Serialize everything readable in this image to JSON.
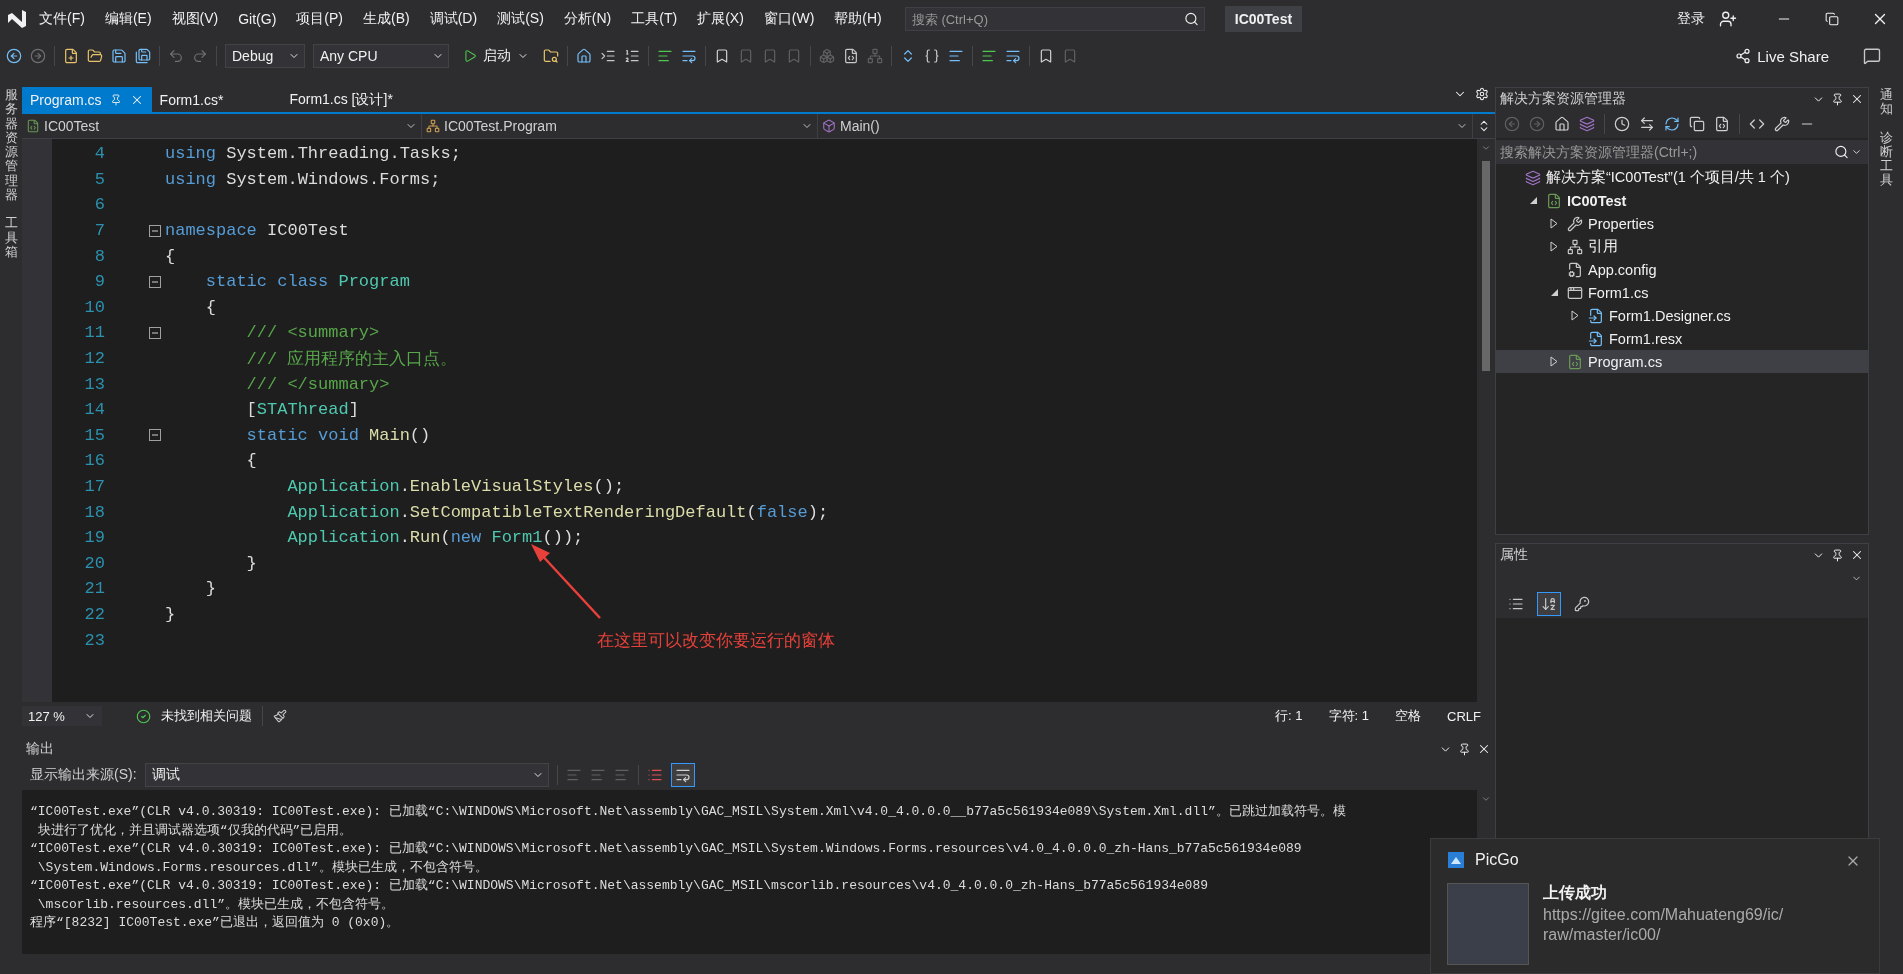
{
  "title_bar": {
    "menu": [
      "文件(F)",
      "编辑(E)",
      "视图(V)",
      "Git(G)",
      "项目(P)",
      "生成(B)",
      "调试(D)",
      "测试(S)",
      "分析(N)",
      "工具(T)",
      "扩展(X)",
      "窗口(W)",
      "帮助(H)"
    ],
    "search": {
      "placeholder": "搜索 (Ctrl+Q)"
    },
    "solution_name": "IC00Test",
    "sign_in": "登录"
  },
  "toolbar": {
    "configuration": "Debug",
    "platform": "Any CPU",
    "start": "启动",
    "live_share": "Live Share"
  },
  "left_strip": [
    "服务器资源管理器",
    "工具箱"
  ],
  "doc_tabs": [
    {
      "label": "Program.cs",
      "selected": true
    },
    {
      "label": "Form1.cs*",
      "selected": false
    },
    {
      "label": "Form1.cs [设计]*",
      "selected": false
    }
  ],
  "nav_bar": {
    "project": "IC00Test",
    "type": "IC00Test.Program",
    "member": "Main()"
  },
  "code_lines": [
    {
      "number": "4",
      "foldable": false,
      "tokens": [
        {
          "kind": "kw",
          "text": "using"
        },
        {
          "kind": "plain",
          "text": " System.Threading.Tasks;"
        }
      ]
    },
    {
      "number": "5",
      "foldable": false,
      "tokens": [
        {
          "kind": "kw",
          "text": "using"
        },
        {
          "kind": "plain",
          "text": " System.Windows.Forms;"
        }
      ]
    },
    {
      "number": "6",
      "foldable": false
    },
    {
      "number": "7",
      "foldable": true,
      "tokens": [
        {
          "kind": "kw",
          "text": "namespace"
        },
        {
          "kind": "plain",
          "text": " IC00Test"
        }
      ]
    },
    {
      "number": "8",
      "foldable": false,
      "tokens": [
        {
          "kind": "plain",
          "text": "{"
        }
      ]
    },
    {
      "number": "9",
      "foldable": true,
      "tokens": [
        {
          "kind": "kw",
          "text": "    static"
        },
        {
          "kind": "kw",
          "text": " class"
        },
        {
          "kind": "type",
          "text": " Program"
        }
      ]
    },
    {
      "number": "10",
      "foldable": false,
      "tokens": [
        {
          "kind": "plain",
          "text": "    {"
        }
      ]
    },
    {
      "number": "11",
      "foldable": true,
      "tokens": [
        {
          "kind": "comment",
          "text": "        /// <summary>"
        }
      ]
    },
    {
      "number": "12",
      "foldable": false,
      "tokens": [
        {
          "kind": "comment",
          "text": "        /// 应用程序的主入口点。"
        }
      ]
    },
    {
      "number": "13",
      "foldable": false,
      "tokens": [
        {
          "kind": "comment",
          "text": "        /// </summary>"
        }
      ]
    },
    {
      "number": "14",
      "foldable": false,
      "tokens": [
        {
          "kind": "plain",
          "text": "        ["
        },
        {
          "kind": "type",
          "text": "STAThread"
        },
        {
          "kind": "plain",
          "text": "]"
        }
      ]
    },
    {
      "number": "15",
      "foldable": true,
      "tokens": [
        {
          "kind": "kw",
          "text": "        static"
        },
        {
          "kind": "kw",
          "text": " void"
        },
        {
          "kind": "method",
          "text": " Main"
        },
        {
          "kind": "plain",
          "text": "()"
        }
      ]
    },
    {
      "number": "16",
      "foldable": false,
      "tokens": [
        {
          "kind": "plain",
          "text": "        {"
        }
      ]
    },
    {
      "number": "17",
      "foldable": false,
      "tokens": [
        {
          "kind": "type",
          "text": "            Application"
        },
        {
          "kind": "plain",
          "text": "."
        },
        {
          "kind": "method",
          "text": "EnableVisualStyles"
        },
        {
          "kind": "plain",
          "text": "();"
        }
      ]
    },
    {
      "number": "18",
      "foldable": false,
      "tokens": [
        {
          "kind": "type",
          "text": "            Application"
        },
        {
          "kind": "plain",
          "text": "."
        },
        {
          "kind": "method",
          "text": "SetCompatibleTextRenderingDefault"
        },
        {
          "kind": "plain",
          "text": "("
        },
        {
          "kind": "kw",
          "text": "false"
        },
        {
          "kind": "plain",
          "text": ");"
        }
      ]
    },
    {
      "number": "19",
      "foldable": false,
      "tokens": [
        {
          "kind": "type",
          "text": "            Application"
        },
        {
          "kind": "plain",
          "text": "."
        },
        {
          "kind": "method",
          "text": "Run"
        },
        {
          "kind": "plain",
          "text": "("
        },
        {
          "kind": "kw",
          "text": "new"
        },
        {
          "kind": "type",
          "text": " Form1"
        },
        {
          "kind": "plain",
          "text": "());"
        }
      ]
    },
    {
      "number": "20",
      "foldable": false,
      "tokens": [
        {
          "kind": "plain",
          "text": "        }"
        }
      ]
    },
    {
      "number": "21",
      "foldable": false,
      "tokens": [
        {
          "kind": "plain",
          "text": "    }"
        }
      ]
    },
    {
      "number": "22",
      "foldable": false,
      "tokens": [
        {
          "kind": "plain",
          "text": "}"
        }
      ]
    },
    {
      "number": "23",
      "foldable": false
    }
  ],
  "annotation": {
    "text": "在这里可以改变你要运行的窗体"
  },
  "editor_status": {
    "zoom": "127 %",
    "issues": "未找到相关问题",
    "line": "行: 1",
    "char": "字符: 1",
    "spaces": "空格",
    "line_ending": "CRLF"
  },
  "output": {
    "title": "输出",
    "source_label": "显示输出来源(S):",
    "source": "调试",
    "lines": [
      "“IC00Test.exe”(CLR v4.0.30319: IC00Test.exe): 已加载“C:\\WINDOWS\\Microsoft.Net\\assembly\\GAC_MSIL\\System.Xml\\v4.0_4.0.0.0__b77a5c561934e089\\System.Xml.dll”。已跳过加载符号。模",
      " 块进行了优化，并且调试器选项“仅我的代码”已启用。",
      "“IC00Test.exe”(CLR v4.0.30319: IC00Test.exe): 已加载“C:\\WINDOWS\\Microsoft.Net\\assembly\\GAC_MSIL\\System.Windows.Forms.resources\\v4.0_4.0.0.0_zh-Hans_b77a5c561934e089",
      " \\System.Windows.Forms.resources.dll”。模块已生成，不包含符号。",
      "“IC00Test.exe”(CLR v4.0.30319: IC00Test.exe): 已加载“C:\\WINDOWS\\Microsoft.Net\\assembly\\GAC_MSIL\\mscorlib.resources\\v4.0_4.0.0.0_zh-Hans_b77a5c561934e089",
      " \\mscorlib.resources.dll”。模块已生成，不包含符号。",
      "程序“[8232] IC00Test.exe”已退出，返回值为 0 (0x0)。"
    ]
  },
  "solution_explorer": {
    "title": "解决方案资源管理器",
    "search": {
      "placeholder": "搜索解决方案资源管理器(Ctrl+;)"
    },
    "tree": [
      {
        "label": "解决方案“IC00Test”(1 个项目/共 1 个)",
        "kind": "solution",
        "selected": false,
        "children": [
          {
            "label": "IC00Test",
            "kind": "project",
            "expanded": true,
            "selected": false,
            "children": [
              {
                "label": "Properties",
                "kind": "properties",
                "expanded": false,
                "selected": false
              },
              {
                "label": "引用",
                "kind": "references",
                "expanded": false,
                "selected": false
              },
              {
                "label": "App.config",
                "kind": "config",
                "selected": false
              },
              {
                "label": "Form1.cs",
                "kind": "form",
                "expanded": true,
                "selected": false,
                "children": [
                  {
                    "label": "Form1.Designer.cs",
                    "kind": "resource",
                    "expanded": false,
                    "selected": false
                  },
                  {
                    "label": "Form1.resx",
                    "kind": "resource",
                    "selected": false
                  }
                ]
              },
              {
                "label": "Program.cs",
                "kind": "csharp",
                "expanded": false,
                "selected": true
              }
            ]
          }
        ]
      }
    ]
  },
  "properties": {
    "title": "属性",
    "tools": [
      {
        "kind": "categorized",
        "selected": false
      },
      {
        "kind": "alphabetical",
        "selected": true
      },
      {
        "kind": "pages",
        "selected": false
      }
    ]
  },
  "right_strip": [
    "通知",
    "诊断工具"
  ],
  "notification": {
    "app": "PicGo",
    "title": "上传成功",
    "lines": [
      "https://gitee.com/Mahuateng69/ic/",
      "raw/master/ic00/"
    ]
  }
}
